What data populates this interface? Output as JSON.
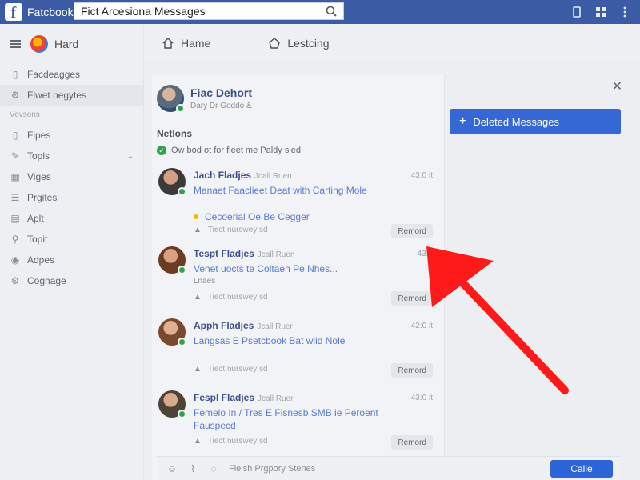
{
  "topbar": {
    "brand": "Fatcbook",
    "search_value": "Fict Arcesiona Messages"
  },
  "sidebar": {
    "header_label": "Hard",
    "items": [
      {
        "label": "Facdeagges",
        "icon": "page-icon"
      },
      {
        "label": "Flwet negytes",
        "icon": "gear-icon"
      }
    ],
    "section_label": "Vevsons",
    "items2": [
      {
        "label": "Fipes",
        "icon": "page-icon"
      },
      {
        "label": "Topls",
        "icon": "tools-icon"
      },
      {
        "label": "Viges",
        "icon": "grid-icon"
      },
      {
        "label": "Prgites",
        "icon": "list-icon"
      },
      {
        "label": "Aplt",
        "icon": "doc-icon"
      },
      {
        "label": "Topit",
        "icon": "pin-icon"
      },
      {
        "label": "Adpes",
        "icon": "settings-icon"
      },
      {
        "label": "Cognage",
        "icon": "gear-icon"
      }
    ]
  },
  "subnav": {
    "home": "Hame",
    "second": "Lestcing"
  },
  "panel": {
    "profile_name": "Fiac Dehort",
    "profile_sub": "Dary Dr Goddo &",
    "section_title": "Netlons",
    "note": "Ow bod ot for fieet me Paldy sied",
    "messages": [
      {
        "name": "Jach Fladjes",
        "meta": "Jcall Ruen",
        "time": "43:0 it",
        "body": "Manaet Faaclieet Deat with Carting Mole",
        "tag": "Cecoerial Oe Be Cegger",
        "foot": "Tiect nurswey sd",
        "remove": "Remord"
      },
      {
        "name": "Tespt Fladjes",
        "meta": "Jcall Ruen",
        "time": "43:0",
        "body": "Venet uocts te Coltaen Pe Nhes...",
        "tag": "Lnaes",
        "foot": "Tiect nurswey sd",
        "remove": "Remord"
      },
      {
        "name": "Apph Fladjes",
        "meta": "Jcall Ruer",
        "time": "42:0 it",
        "body": "Langsas E Psetcbook Bat wlid Nole",
        "tag": "",
        "foot": "Tiect nurswey sd",
        "remove": "Remord"
      },
      {
        "name": "Fespl Fladjes",
        "meta": "Jcall Ruer",
        "time": "43:0 it",
        "body": "Femelo In / Tres E Fisnesb SMB ie Peroent Fauspecd",
        "tag": "",
        "foot": "Tiect nurswey sd",
        "remove": "Remord"
      }
    ]
  },
  "composer": {
    "text": "Fielsh Prgpory Stenes",
    "call_label": "Calle"
  },
  "right": {
    "deleted_label": "Deleted Messages"
  }
}
